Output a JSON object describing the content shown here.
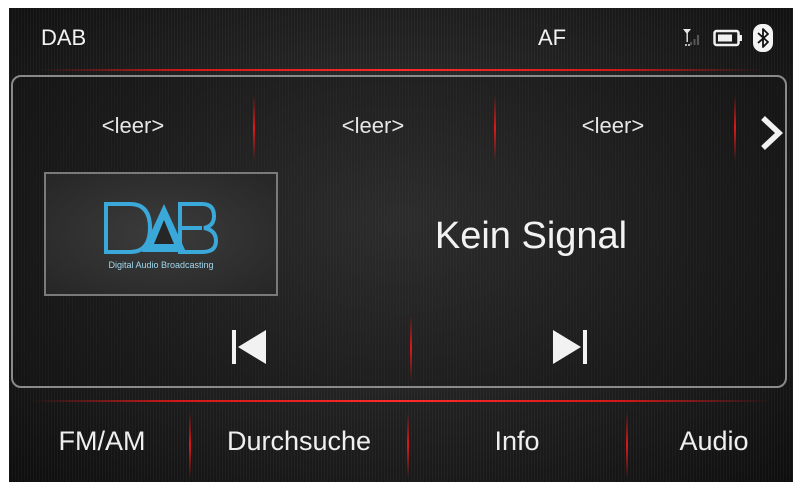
{
  "status": {
    "source": "DAB",
    "af": "AF"
  },
  "presets": [
    "<leer>",
    "<leer>",
    "<leer>"
  ],
  "station_logo": {
    "text": "DAB",
    "subtitle": "Digital Audio Broadcasting"
  },
  "signal_status": "Kein Signal",
  "nav": [
    "FM/AM",
    "Durchsuche",
    "Info",
    "Audio"
  ],
  "icons": {
    "signal": "antenna-signal-icon",
    "battery": "battery-icon",
    "bluetooth": "bluetooth-icon",
    "next": "chevron-right-icon",
    "prev_track": "skip-previous-icon",
    "next_track": "skip-next-icon"
  },
  "colors": {
    "accent_red": "#e01818",
    "logo_blue": "#3aa8d8",
    "text": "#f2f2f2"
  }
}
